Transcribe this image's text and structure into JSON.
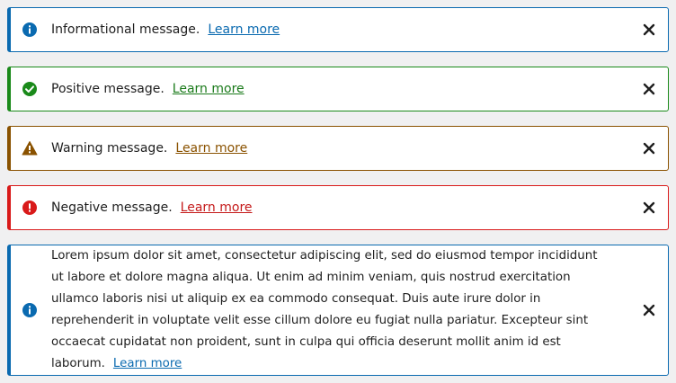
{
  "notices": [
    {
      "type": "info",
      "message": "Informational message.",
      "link": "Learn more",
      "icon": "info-icon",
      "color": "#0a6ab0"
    },
    {
      "type": "positive",
      "message": "Positive message.",
      "link": "Learn more",
      "icon": "check-circle-icon",
      "color": "#1a8a1a"
    },
    {
      "type": "warning",
      "message": "Warning message.",
      "link": "Learn more",
      "icon": "warning-icon",
      "color": "#8a5200"
    },
    {
      "type": "negative",
      "message": "Negative message.",
      "link": "Learn more",
      "icon": "error-icon",
      "color": "#d91a1a"
    },
    {
      "type": "info",
      "message": "Lorem ipsum dolor sit amet, consectetur adipiscing elit, sed do eiusmod tempor incididunt ut labore et dolore magna aliqua. Ut enim ad minim veniam, quis nostrud exercitation ullamco laboris nisi ut aliquip ex ea commodo consequat. Duis aute irure dolor in reprehenderit in voluptate velit esse cillum dolore eu fugiat nulla pariatur. Excepteur sint occaecat cupidatat non proident, sunt in culpa qui officia deserunt mollit anim id est laborum.",
      "link": "Learn more",
      "icon": "info-icon",
      "color": "#0a6ab0"
    }
  ],
  "close_icon": "close-icon"
}
